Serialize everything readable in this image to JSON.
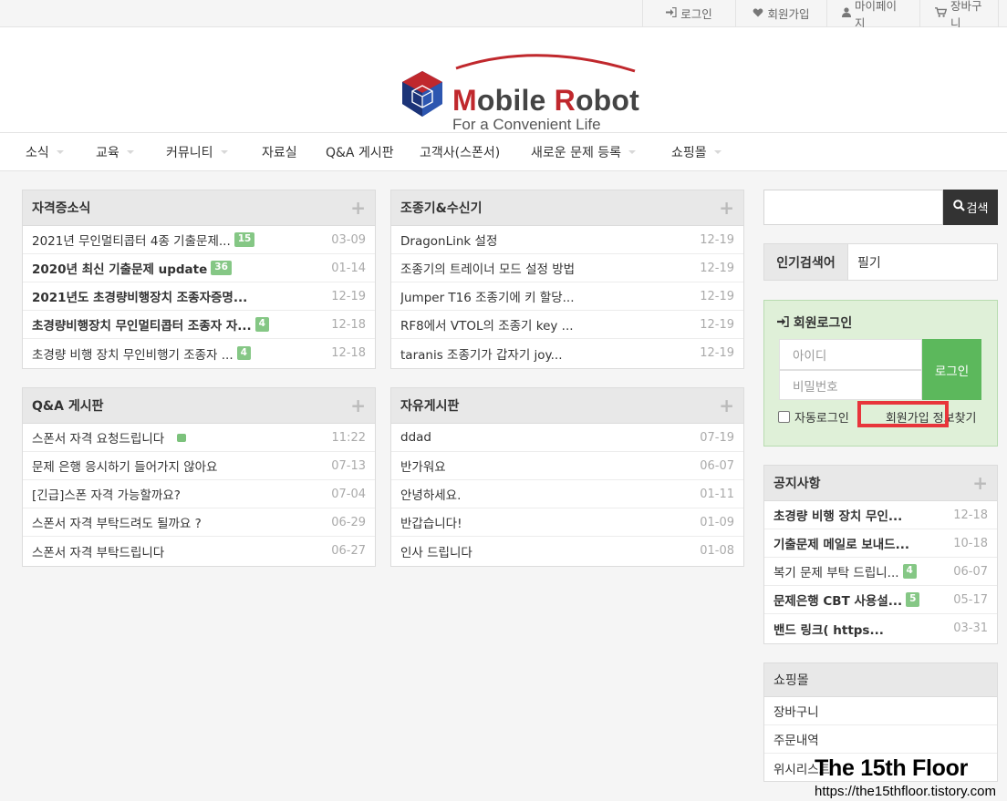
{
  "topbar": {
    "login": "로그인",
    "signup": "회원가입",
    "mypage": "마이페이지",
    "cart": "장바구니"
  },
  "logo": {
    "brand_m": "M",
    "brand_1": "obile ",
    "brand_r": "R",
    "brand_2": "obot",
    "tagline": "For a Convenient Life"
  },
  "nav": {
    "items": [
      "소식",
      "교육",
      "커뮤니티",
      "자료실",
      "Q&A 게시판",
      "고객사(스폰서)",
      "새로운 문제 등록",
      "쇼핑몰"
    ]
  },
  "panels": {
    "news": {
      "title": "자격증소식",
      "rows": [
        {
          "text": "2021년 무인멀티콥터 4종 기출문제...",
          "badge": "15",
          "date": "03-09"
        },
        {
          "text": "2020년 최신 기출문제 update",
          "badge": "36",
          "date": "01-14"
        },
        {
          "text": "2021년도 초경량비행장치 조종자증명...",
          "badge": "",
          "date": "12-19"
        },
        {
          "text": "초경량비행장치 무인멀티콥터 조종자 자...",
          "badge": "4",
          "date": "12-18"
        },
        {
          "text": "초경량 비행 장치 무인비행기 조종자 ...",
          "badge": "4",
          "date": "12-18"
        }
      ]
    },
    "radio": {
      "title": "조종기&수신기",
      "rows": [
        {
          "text": "DragonLink 설정",
          "date": "12-19"
        },
        {
          "text": "조종기의 트레이너 모드 설정 방법",
          "date": "12-19"
        },
        {
          "text": "Jumper T16 조종기에 키 할당...",
          "date": "12-19"
        },
        {
          "text": "RF8에서 VTOL의 조종기 key ...",
          "date": "12-19"
        },
        {
          "text": "taranis 조종기가 갑자기 joy...",
          "date": "12-19"
        }
      ]
    },
    "qna": {
      "title": "Q&A 게시판",
      "rows": [
        {
          "text": "스폰서 자격 요청드립니다",
          "date": "11:22"
        },
        {
          "text": "문제 은행 응시하기 들어가지 않아요",
          "date": "07-13"
        },
        {
          "text": "[긴급]스폰 자격 가능할까요?",
          "date": "07-04"
        },
        {
          "text": "스폰서 자격 부탁드려도 될까요 ?",
          "date": "06-29"
        },
        {
          "text": "스폰서 자격 부탁드립니다",
          "date": "06-27"
        }
      ]
    },
    "free": {
      "title": "자유게시판",
      "rows": [
        {
          "text": "ddad",
          "date": "07-19"
        },
        {
          "text": "반가워요",
          "date": "06-07"
        },
        {
          "text": "안녕하세요.",
          "date": "01-11"
        },
        {
          "text": "반갑습니다!",
          "date": "01-09"
        },
        {
          "text": "인사 드립니다",
          "date": "01-08"
        }
      ]
    },
    "notice": {
      "title": "공지사항",
      "rows": [
        {
          "text": "초경량 비행 장치 무인...",
          "badge": "",
          "date": "12-18"
        },
        {
          "text": "기출문제 메일로 보내드...",
          "badge": "",
          "date": "10-18"
        },
        {
          "text": "복기 문제 부탁 드립니...",
          "badge": "4",
          "date": "06-07"
        },
        {
          "text": "문제은행 CBT 사용설...",
          "badge": "5",
          "date": "05-17"
        },
        {
          "text": "밴드 링크( https...",
          "badge": "",
          "date": "03-31"
        }
      ]
    },
    "shop": {
      "title": "쇼핑몰",
      "rows": [
        "장바구니",
        "주문내역",
        "위시리스트"
      ]
    }
  },
  "search": {
    "button": "검색",
    "placeholder": ""
  },
  "popular": {
    "label": "인기검색어",
    "value": "필기"
  },
  "login_box": {
    "title": "회원로그인",
    "id_placeholder": "아이디",
    "pw_placeholder": "비밀번호",
    "button": "로그인",
    "auto_login": "자동로그인",
    "signup": "회원가입",
    "find_info": "정보찾기"
  },
  "watermark": {
    "title": "The 15th Floor",
    "url": "https://the15thfloor.tistory.com"
  },
  "colors": {
    "badge": "#85c785",
    "login_button": "#5cb85c",
    "login_box_bg": "#dff0d8",
    "highlight": "#e8353b",
    "brand_red": "#c0282d"
  }
}
